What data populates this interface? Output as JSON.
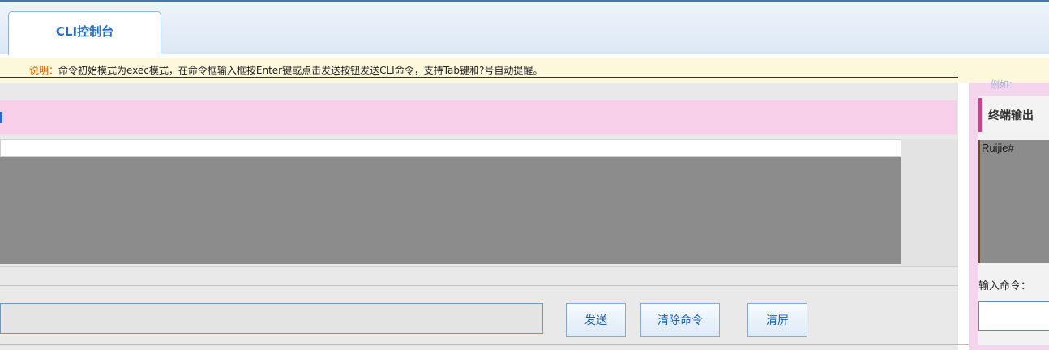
{
  "tabs": [
    {
      "label": "CLI控制台",
      "active": true
    }
  ],
  "notice": {
    "label": "说明：",
    "text": "命令初始模式为exec模式，在命令框输入框按Enter键或点击发送按钮发送CLI命令，支持Tab键和?号自动提醒。"
  },
  "right_top_text": "例如：",
  "output_panel": {
    "title": "终端输出",
    "terminal_text": "Ruijie#"
  },
  "command_panel": {
    "prompt_label": "输入命令：",
    "input_value": "",
    "right_input_value": ""
  },
  "buttons": {
    "send": "发送",
    "clear_command": "清除命令",
    "clear_screen": "清屏"
  },
  "colors": {
    "accent": "#2a6cbf",
    "pink": "#f7cfe9",
    "terminal_bg": "#8c8c8c",
    "notice_bg": "#fdf7dc"
  }
}
